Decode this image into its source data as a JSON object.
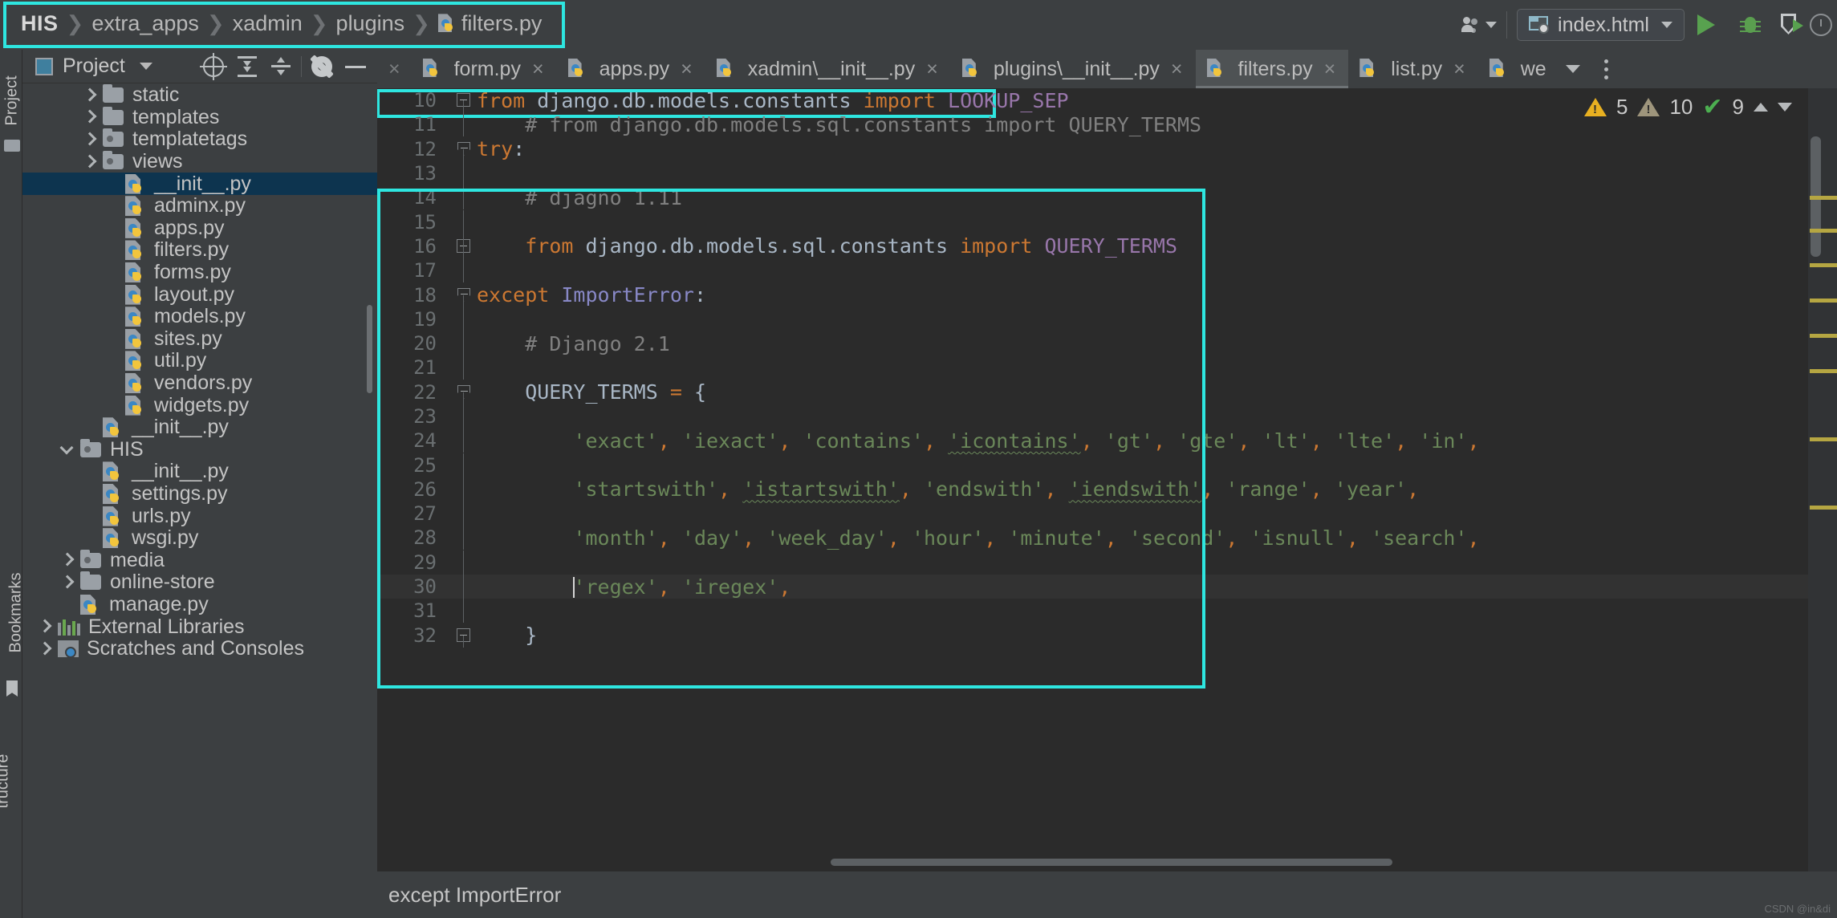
{
  "window": {
    "breadcrumb": [
      "HIS",
      "extra_apps",
      "xadmin",
      "plugins",
      "filters.py"
    ],
    "run_config": "index.html"
  },
  "project_panel": {
    "title": "Project",
    "tree": [
      {
        "label": "static",
        "indent": 3,
        "type": "folder",
        "expand": "right"
      },
      {
        "label": "templates",
        "indent": 3,
        "type": "folder",
        "expand": "right"
      },
      {
        "label": "templatetags",
        "indent": 3,
        "type": "folder-mod",
        "expand": "right"
      },
      {
        "label": "views",
        "indent": 3,
        "type": "folder-mod",
        "expand": "right"
      },
      {
        "label": "__init__.py",
        "indent": 4,
        "type": "py",
        "expand": "none",
        "selected": true
      },
      {
        "label": "adminx.py",
        "indent": 4,
        "type": "py",
        "expand": "none"
      },
      {
        "label": "apps.py",
        "indent": 4,
        "type": "py",
        "expand": "none"
      },
      {
        "label": "filters.py",
        "indent": 4,
        "type": "py",
        "expand": "none"
      },
      {
        "label": "forms.py",
        "indent": 4,
        "type": "py",
        "expand": "none"
      },
      {
        "label": "layout.py",
        "indent": 4,
        "type": "py",
        "expand": "none"
      },
      {
        "label": "models.py",
        "indent": 4,
        "type": "py",
        "expand": "none"
      },
      {
        "label": "sites.py",
        "indent": 4,
        "type": "py",
        "expand": "none"
      },
      {
        "label": "util.py",
        "indent": 4,
        "type": "py",
        "expand": "none"
      },
      {
        "label": "vendors.py",
        "indent": 4,
        "type": "py",
        "expand": "none"
      },
      {
        "label": "widgets.py",
        "indent": 4,
        "type": "py",
        "expand": "none"
      },
      {
        "label": "__init__.py",
        "indent": 3,
        "type": "py",
        "expand": "none"
      },
      {
        "label": "HIS",
        "indent": 2,
        "type": "folder-mod",
        "expand": "down"
      },
      {
        "label": "__init__.py",
        "indent": 3,
        "type": "py",
        "expand": "none"
      },
      {
        "label": "settings.py",
        "indent": 3,
        "type": "py",
        "expand": "none"
      },
      {
        "label": "urls.py",
        "indent": 3,
        "type": "py",
        "expand": "none"
      },
      {
        "label": "wsgi.py",
        "indent": 3,
        "type": "py",
        "expand": "none"
      },
      {
        "label": "media",
        "indent": 2,
        "type": "folder-mod",
        "expand": "right"
      },
      {
        "label": "online-store",
        "indent": 2,
        "type": "folder",
        "expand": "right"
      },
      {
        "label": "manage.py",
        "indent": 2,
        "type": "py",
        "expand": "none"
      },
      {
        "label": "External Libraries",
        "indent": 1,
        "type": "lib",
        "expand": "right"
      },
      {
        "label": "Scratches and Consoles",
        "indent": 1,
        "type": "scratch",
        "expand": "right"
      }
    ]
  },
  "rails": {
    "project": "Project",
    "bookmarks": "Bookmarks",
    "structure": "tructure"
  },
  "editor": {
    "tabs": [
      {
        "label": "form.py",
        "active": false
      },
      {
        "label": "apps.py",
        "active": false
      },
      {
        "label": "xadmin\\__init__.py",
        "active": false
      },
      {
        "label": "plugins\\__init__.py",
        "active": false
      },
      {
        "label": "filters.py",
        "active": true
      },
      {
        "label": "list.py",
        "active": false
      },
      {
        "label": "we",
        "active": false
      }
    ],
    "inspector": {
      "warnings": "5",
      "weak_warnings": "10",
      "checks": "9"
    },
    "lines": [
      {
        "n": "10",
        "fold": "end",
        "html": "<span class=\"k\">from</span> django.db.models.constants <span class=\"k\">import</span> <span class=\"cst\">LOOKUP_SEP</span>",
        "text": "from django.db.models.constants import LOOKUP_SEP"
      },
      {
        "n": "11",
        "fold": "line",
        "html": "    <span class=\"cm\"># from django.db.models.sql.constants import QUERY_TERMS</span>",
        "text": "    # from django.db.models.sql.constants import QUERY_TERMS"
      },
      {
        "n": "12",
        "fold": "tri",
        "html": "<span class=\"k\">try</span>:",
        "text": "try:"
      },
      {
        "n": "13",
        "fold": "line",
        "html": "",
        "text": ""
      },
      {
        "n": "14",
        "fold": "line",
        "html": "    <span class=\"cm\"># djagno 1.11</span>",
        "text": "    # djagno 1.11"
      },
      {
        "n": "15",
        "fold": "line",
        "html": "",
        "text": ""
      },
      {
        "n": "16",
        "fold": "end2",
        "html": "    <span class=\"k\">from</span> django.db.models.sql.constants <span class=\"k\">import</span> <span class=\"cst\">QUERY_TERMS</span>",
        "text": "    from django.db.models.sql.constants import QUERY_TERMS"
      },
      {
        "n": "17",
        "fold": "line",
        "html": "",
        "text": ""
      },
      {
        "n": "18",
        "fold": "tri",
        "html": "<span class=\"k\">except</span> <span class=\"exc\">ImportError</span>:",
        "text": "except ImportError:"
      },
      {
        "n": "19",
        "fold": "line",
        "html": "",
        "text": ""
      },
      {
        "n": "20",
        "fold": "line",
        "html": "    <span class=\"cm\"># Django 2.1</span>",
        "text": "    # Django 2.1"
      },
      {
        "n": "21",
        "fold": "line",
        "html": "",
        "text": ""
      },
      {
        "n": "22",
        "fold": "tri",
        "html": "    QUERY_TERMS <span class=\"pun\">=</span> {",
        "text": "    QUERY_TERMS = {"
      },
      {
        "n": "23",
        "fold": "line",
        "html": "",
        "text": ""
      },
      {
        "n": "24",
        "fold": "line",
        "html": "        <span class=\"str\">'exact'</span><span class=\"pun\">,</span> <span class=\"str\">'iexact'</span><span class=\"pun\">,</span> <span class=\"str\">'contains'</span><span class=\"pun\">,</span> <span class=\"str spell\">'icontains'</span><span class=\"pun\">,</span> <span class=\"str\">'gt'</span><span class=\"pun\">,</span> <span class=\"str\">'gte'</span><span class=\"pun\">,</span> <span class=\"str\">'lt'</span><span class=\"pun\">,</span> <span class=\"str\">'lte'</span><span class=\"pun\">,</span> <span class=\"str\">'in'</span><span class=\"pun\">,</span>",
        "text": "        'exact', 'iexact', 'contains', 'icontains', 'gt', 'gte', 'lt', 'lte', 'in',"
      },
      {
        "n": "25",
        "fold": "line",
        "html": "",
        "text": ""
      },
      {
        "n": "26",
        "fold": "line",
        "html": "        <span class=\"str\">'startswith'</span><span class=\"pun\">,</span> <span class=\"str spell\">'istartswith'</span><span class=\"pun\">,</span> <span class=\"str\">'endswith'</span><span class=\"pun\">,</span> <span class=\"str spell\">'iendswith'</span><span class=\"pun\">,</span> <span class=\"str\">'range'</span><span class=\"pun\">,</span> <span class=\"str\">'year'</span><span class=\"pun\">,</span>",
        "text": "        'startswith', 'istartswith', 'endswith', 'iendswith', 'range', 'year',"
      },
      {
        "n": "27",
        "fold": "line",
        "html": "",
        "text": ""
      },
      {
        "n": "28",
        "fold": "line",
        "html": "        <span class=\"str\">'month'</span><span class=\"pun\">,</span> <span class=\"str\">'day'</span><span class=\"pun\">,</span> <span class=\"str\">'week_day'</span><span class=\"pun\">,</span> <span class=\"str\">'hour'</span><span class=\"pun\">,</span> <span class=\"str\">'minute'</span><span class=\"pun\">,</span> <span class=\"str\">'second'</span><span class=\"pun\">,</span> <span class=\"str\">'isnull'</span><span class=\"pun\">,</span> <span class=\"str\">'search'</span><span class=\"pun\">,</span>",
        "text": "        'month', 'day', 'week_day', 'hour', 'minute', 'second', 'isnull', 'search',"
      },
      {
        "n": "29",
        "fold": "line",
        "html": "",
        "text": ""
      },
      {
        "n": "30",
        "fold": "line",
        "html": "        <span class=\"caret-bar\"></span><span class=\"str\">'regex'</span><span class=\"pun\">,</span> <span class=\"str\">'iregex'</span><span class=\"pun\">,</span>",
        "text": "        'regex', 'iregex',",
        "highlight": true
      },
      {
        "n": "31",
        "fold": "line",
        "html": "",
        "text": ""
      },
      {
        "n": "32",
        "fold": "end",
        "html": "    }",
        "text": "    }"
      }
    ]
  },
  "status": {
    "text": "except ImportError"
  },
  "watermark": "CSDN @in&di",
  "colors": {
    "highlight": "#2ee6e0",
    "selection": "#0d344f",
    "editor_bg": "#2b2b2b",
    "panel_bg": "#3c3f41",
    "string": "#6a8759",
    "keyword": "#cc7832",
    "comment": "#808080",
    "constant": "#9876aa"
  }
}
